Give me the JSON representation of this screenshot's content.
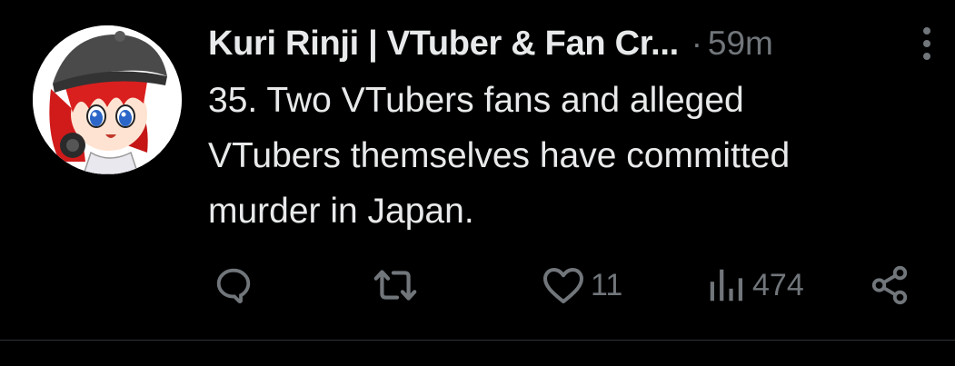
{
  "tweet": {
    "author_name": "Kuri Rinji | VTuber & Fan Cr...",
    "separator": "·",
    "timestamp": "59m",
    "text": "35. Two VTubers fans and alleged\nVTubers themselves have committed\nmurder in Japan.",
    "avatar_icon": "profile-avatar-anime-character",
    "actions": {
      "reply_icon": "reply-icon",
      "reply_count": "",
      "retweet_icon": "retweet-icon",
      "retweet_count": "",
      "like_icon": "heart-icon",
      "like_count": "11",
      "views_icon": "views-chart-icon",
      "views_count": "474",
      "share_icon": "share-icon"
    }
  },
  "colors": {
    "background": "#000000",
    "text_primary": "#e7e9ea",
    "text_secondary": "#71767b",
    "divider": "#2f3336"
  }
}
